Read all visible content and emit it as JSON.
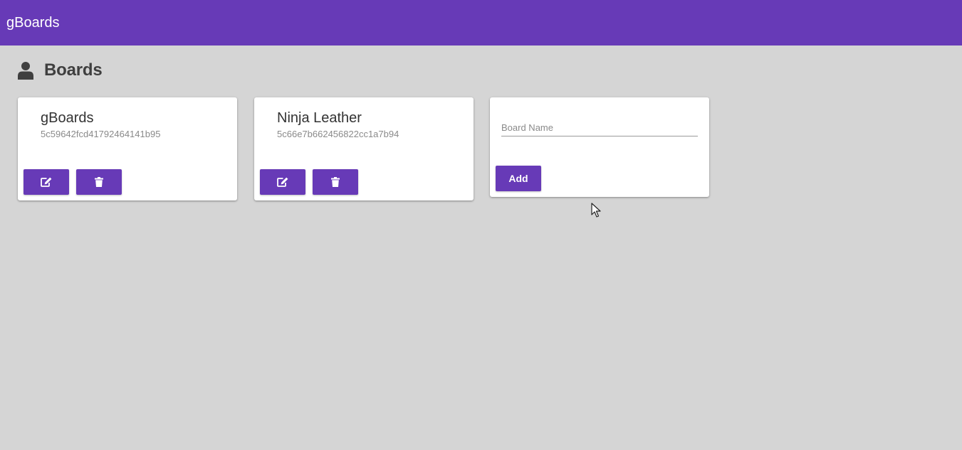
{
  "app": {
    "title": "gBoards",
    "accent_color": "#673ab7",
    "background_color": "#d5d5d5"
  },
  "header": {
    "icon": "user-icon",
    "title": "Boards"
  },
  "boards": [
    {
      "name": "gBoards",
      "id": "5c59642fcd41792464141b95",
      "edit_icon": "edit-icon",
      "delete_icon": "trash-icon"
    },
    {
      "name": "Ninja Leather",
      "id": "5c66e7b662456822cc1a7b94",
      "edit_icon": "edit-icon",
      "delete_icon": "trash-icon"
    }
  ],
  "add_form": {
    "placeholder": "Board Name",
    "value": "",
    "button_label": "Add"
  }
}
